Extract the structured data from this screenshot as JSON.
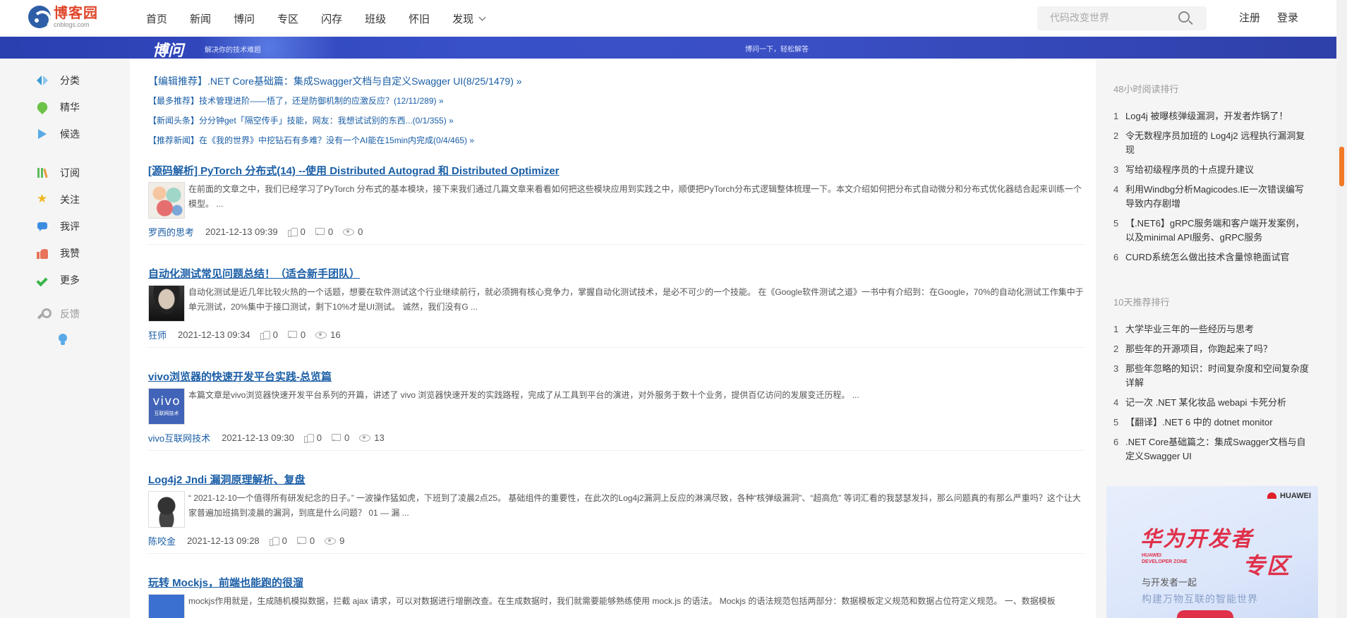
{
  "header": {
    "logo_title": "博客园",
    "logo_sub": "cnblogs.com",
    "nav": [
      "首页",
      "新闻",
      "博问",
      "专区",
      "闪存",
      "班级",
      "怀旧",
      "发现"
    ],
    "search_placeholder": "代码改变世界",
    "register": "注册",
    "login": "登录"
  },
  "banner": {
    "logo": "博问",
    "subtitle": "解决你的技术难题",
    "right_text": "博问一下，轻松解答"
  },
  "sidebar": {
    "items": [
      {
        "label": "分类",
        "icon": "category-icon"
      },
      {
        "label": "精华",
        "icon": "essence-icon"
      },
      {
        "label": "候选",
        "icon": "candidate-icon"
      },
      {
        "label": "订阅",
        "icon": "subscribe-icon"
      },
      {
        "label": "关注",
        "icon": "star-icon"
      },
      {
        "label": "我评",
        "icon": "comment-icon"
      },
      {
        "label": "我赞",
        "icon": "thumbs-up-icon"
      },
      {
        "label": "更多",
        "icon": "check-icon"
      },
      {
        "label": "反馈",
        "icon": "wrench-icon"
      }
    ]
  },
  "headlines": [
    "【编辑推荐】.NET Core基础篇：集成Swagger文档与自定义Swagger UI(8/25/1479) »",
    "【最多推荐】技术管理进阶——悟了，还是防御机制的应激反应？(12/11/289) »",
    "【新闻头条】分分钟get「隔空传手」技能，网友：我想试试别的东西...(0/1/355) »",
    "【推荐新闻】在《我的世界》中挖钻石有多难？没有一个AI能在15min内完成(0/4/465) »"
  ],
  "posts": [
    {
      "title": "[源码解析] PyTorch 分布式(14) --使用 Distributed Autograd 和 Distributed Optimizer",
      "summary": "在前面的文章之中，我们已经学习了PyTorch 分布式的基本模块，接下来我们通过几篇文章来看看如何把这些模块应用到实践之中，顺便把PyTorch分布式逻辑整体梳理一下。本文介绍如何把分布式自动微分和分布式优化器结合起来训练一个模型。 ...",
      "author": "罗西的思考",
      "date": "2021-12-13 09:39",
      "likes": "0",
      "comments": "0",
      "views": "0"
    },
    {
      "title": "自动化测试常见问题总结！（适合新手团队）",
      "summary": "自动化测试是近几年比较火热的一个话题，想要在软件测试这个行业继续前行，就必须拥有核心竞争力，掌握自动化测试技术，是必不可少的一个技能。 在《Google软件测试之道》一书中有介绍到：在Google，70%的自动化测试工作集中于单元测试，20%集中于接口测试，剩下10%才是UI测试。 诚然，我们没有G ...",
      "author": "狂师",
      "date": "2021-12-13 09:34",
      "likes": "0",
      "comments": "0",
      "views": "16"
    },
    {
      "title": "vivo浏览器的快速开发平台实践-总览篇",
      "summary": "本篇文章是vivo浏览器快速开发平台系列的开篇，讲述了 vivo 浏览器快速开发的实践路程，完成了从工具到平台的演进，对外服务于数十个业务，提供百亿访问的发展变迁历程。 ...",
      "author": "vivo互联网技术",
      "date": "2021-12-13 09:30",
      "likes": "0",
      "comments": "0",
      "views": "13",
      "avatar_text": "vivo",
      "avatar_sub": "互联网技术"
    },
    {
      "title": "Log4j2 Jndi 漏洞原理解析、复盘",
      "summary": "“ 2021-12-10一个值得所有研发纪念的日子。” 一波操作猛如虎，下班到了凌晨2点25。 基础组件的重要性，在此次的Log4j2漏洞上反应的淋漓尽致，各种“核弹级漏洞”、“超高危” 等词汇看的我瑟瑟发抖，那么问题真的有那么严重吗？这个让大家普遍加班搞到凌晨的漏洞，到底是什么问题？ 01 — 漏 ...",
      "author": "陈咬金",
      "date": "2021-12-13 09:28",
      "likes": "0",
      "comments": "0",
      "views": "9"
    },
    {
      "title": "玩转 Mockjs，前端也能跑的很溜",
      "summary": "mockjs作用就是，生成随机模拟数据，拦截 ajax 请求，可以对数据进行增删改查。在生成数据时，我们就需要能够熟练使用 mock.js 的语法。 Mockjs 的语法规范包括两部分：数据模板定义规范和数据占位符定义规范。 一、数据模板"
    }
  ],
  "right": {
    "rank48_title": "48小时阅读排行",
    "rank48": [
      "Log4j 被曝核弹级漏洞，开发者炸锅了！",
      "令无数程序员加班的 Log4j2 远程执行漏洞复现",
      "写给初级程序员的十点提升建议",
      "利用Windbg分析Magicodes.IE一次错误编写导致内存剧增",
      "【.NET6】gRPC服务端和客户端开发案例，以及minimal API服务、gRPC服务",
      "CURD系统怎么做出技术含量惊艳面试官"
    ],
    "rank10_title": "10天推荐排行",
    "rank10": [
      "大学毕业三年的一些经历与思考",
      "那些年的开源项目，你跑起来了吗？",
      "那些年忽略的知识：时间复杂度和空间复杂度详解",
      "记一次 .NET 某化妆品 webapi 卡死分析",
      "【翻译】.NET 6 中的 dotnet monitor",
      ".NET Core基础篇之：集成Swagger文档与自定义Swagger UI"
    ],
    "ad": {
      "brand": "HUAWEI",
      "title": "华为开发者",
      "title2": "专区",
      "zone_line1": "HUAWEI",
      "zone_line2": "DEVELOPER ZONE",
      "line1": "与开发者一起",
      "line2": "构建万物互联的智能世界"
    }
  },
  "colors": {
    "link": "#1a5ea6",
    "brand": "#e0472c",
    "banner": "#3850c8",
    "scroll_thumb": "#f07a28"
  }
}
